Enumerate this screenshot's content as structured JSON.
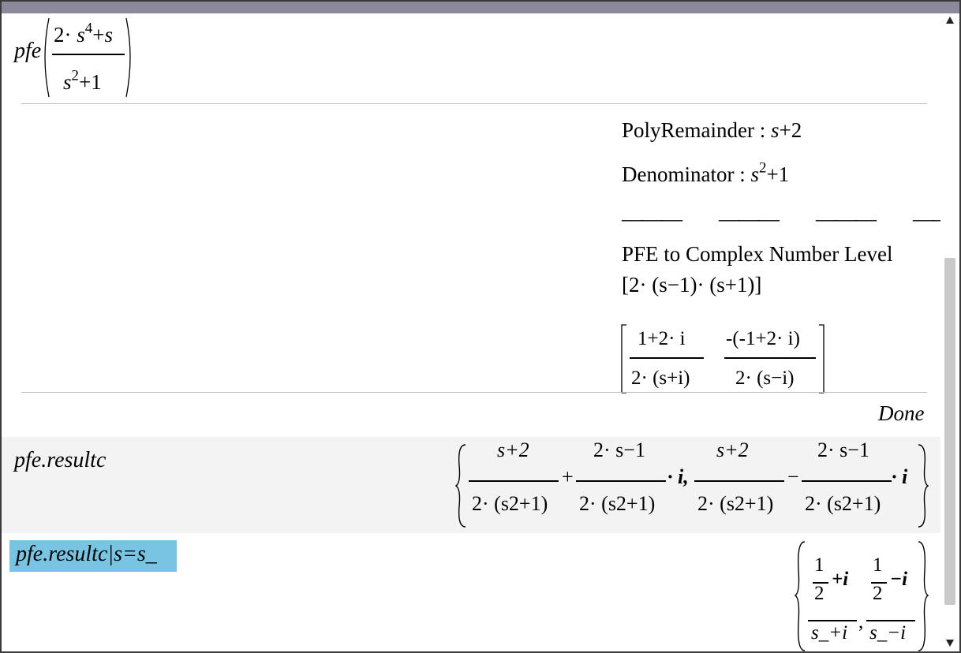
{
  "entries": {
    "pfe_call": {
      "func": "pfe",
      "num": [
        "2",
        "·",
        "s",
        "4",
        "+",
        "s"
      ],
      "den": [
        "s",
        "2",
        "+1"
      ]
    },
    "output": {
      "poly_remainder_label": "PolyRemainder",
      "colon": ":",
      "poly_remainder_val_s": "s",
      "poly_remainder_val_rest": "+2",
      "denominator_label": "Denominator",
      "denominator_s": "s",
      "denominator_exp": "2",
      "denominator_rest": "+1",
      "dashes": [
        "———",
        "———",
        "———",
        "———"
      ],
      "pfe_level": "PFE to Complex Number Level",
      "factor_vector": "2· (s−1)· (s+1)",
      "frac1_num": "1+2· i",
      "frac1_den": "2· (s+i)",
      "frac2_num": "-(-1+2· i)",
      "frac2_den": "2· (s−i)",
      "done": "Done"
    },
    "resultc": {
      "input": "pfe.resultc",
      "t1_num": "s+2",
      "t1_den": "2· (s2+1)",
      "op1": "+",
      "t2_num": "2· s−1",
      "t2_den": "2· (s2+1)",
      "i1": "· i,",
      "t3_num": "s+2",
      "t3_den": "2· (s2+1)",
      "op2": "−",
      "t4_num": "2· s−1",
      "t4_den": "2· (s2+1)",
      "i2": "· i"
    },
    "subst": {
      "input": "pfe.resultc|s=s_",
      "a_top_num": "1",
      "a_top_den": "2",
      "a_top_rest": "+i",
      "a_den": "s_+i",
      "comma": ",",
      "b_top_num": "1",
      "b_top_den": "2",
      "b_top_rest": "−i",
      "b_den": "s_−i"
    }
  }
}
